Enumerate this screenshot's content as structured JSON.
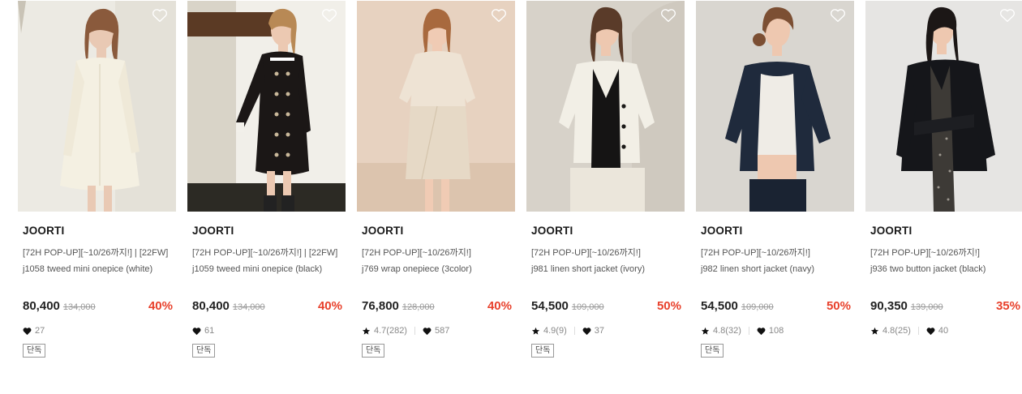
{
  "colors": {
    "discount": "#e8412c",
    "price": "#222222",
    "original_price": "#999999"
  },
  "products": [
    {
      "brand": "JOORTI",
      "promo": "[72H POP-UP][~10/26까지!] | [22FW]",
      "name": "j1058 tweed mini onepice (white)",
      "price": "80,400",
      "original_price": "134,000",
      "discount": "40%",
      "rating": null,
      "likes": "27",
      "badge": "단독",
      "image": "model-white-tweed-dress"
    },
    {
      "brand": "JOORTI",
      "promo": "[72H POP-UP][~10/26까지!] | [22FW]",
      "name": "j1059 tweed mini onepice (black)",
      "price": "80,400",
      "original_price": "134,000",
      "discount": "40%",
      "rating": null,
      "likes": "61",
      "badge": "단독",
      "image": "model-black-tweed-dress"
    },
    {
      "brand": "JOORTI",
      "promo": "[72H POP-UP][~10/26까지!]",
      "name": "j769 wrap onepiece (3color)",
      "price": "76,800",
      "original_price": "128,000",
      "discount": "40%",
      "rating": "4.7(282)",
      "likes": "587",
      "badge": "단독",
      "image": "model-beige-wrap-dress"
    },
    {
      "brand": "JOORTI",
      "promo": "[72H POP-UP][~10/26까지!]",
      "name": "j981 linen short jacket (ivory)",
      "price": "54,500",
      "original_price": "109,000",
      "discount": "50%",
      "rating": "4.9(9)",
      "likes": "37",
      "badge": "단독",
      "image": "model-ivory-linen-jacket"
    },
    {
      "brand": "JOORTI",
      "promo": "[72H POP-UP][~10/26까지!]",
      "name": "j982 linen short jacket (navy)",
      "price": "54,500",
      "original_price": "109,000",
      "discount": "50%",
      "rating": "4.8(32)",
      "likes": "108",
      "badge": "단독",
      "image": "model-navy-linen-jacket"
    },
    {
      "brand": "JOORTI",
      "promo": "[72H POP-UP][~10/26까지!]",
      "name": "j936 two button jacket (black)",
      "price": "90,350",
      "original_price": "139,000",
      "discount": "35%",
      "rating": "4.8(25)",
      "likes": "40",
      "badge": null,
      "image": "model-black-two-button-jacket"
    }
  ]
}
